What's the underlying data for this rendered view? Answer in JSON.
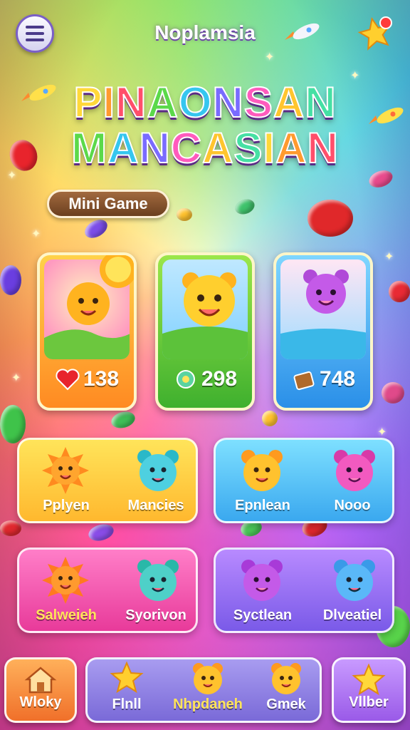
{
  "header": {
    "title": "Noplamsia",
    "menu_icon": "hamburger-menu-icon",
    "corner_icon": "star-notification-icon"
  },
  "logo": {
    "line1": [
      "P",
      "I",
      "N",
      "A",
      "O",
      "N",
      "S",
      "A",
      "N"
    ],
    "line2": [
      "M",
      "A",
      "N",
      "C",
      "A",
      "S",
      "I",
      "A",
      "N"
    ],
    "colors": [
      "#ffd83a",
      "#ff9a2e",
      "#ff4f6b",
      "#5bd94a",
      "#36c6ef",
      "#7a6bff",
      "#ff5bbd",
      "#ffc52e",
      "#46e0a4"
    ]
  },
  "mini_game_label": "Mini Game",
  "level_cards": [
    {
      "score": "138",
      "icon": "heart-icon",
      "scene": "sunny-meadow",
      "accent": "#ff9a2e"
    },
    {
      "score": "298",
      "icon": "flower-icon",
      "scene": "jungle",
      "accent": "#6ed13e"
    },
    {
      "score": "748",
      "icon": "chest-icon",
      "scene": "ocean-island",
      "accent": "#38a8f0"
    }
  ],
  "panels": [
    {
      "color": "yellow",
      "characters": [
        {
          "name": "Pplyen",
          "icon": "sun-creature-icon"
        },
        {
          "name": "Mancies",
          "icon": "blue-bear-icon"
        }
      ]
    },
    {
      "color": "blue",
      "characters": [
        {
          "name": "Epnlean",
          "icon": "yellow-bear-icon"
        },
        {
          "name": "Nooo",
          "icon": "pink-bear-icon"
        }
      ]
    },
    {
      "color": "pink",
      "characters": [
        {
          "name": "Salweieh",
          "icon": "sun-creature-icon"
        },
        {
          "name": "Syorivon",
          "icon": "teal-bear-icon"
        }
      ]
    },
    {
      "color": "purple",
      "characters": [
        {
          "name": "Syctlean",
          "icon": "purple-bear-icon"
        },
        {
          "name": "Dlveatiel",
          "icon": "blue-bear-icon"
        }
      ]
    }
  ],
  "nav": [
    {
      "label": "Wloky",
      "icon": "home-icon"
    },
    {
      "label": "Flnll",
      "icon": "star-icon"
    },
    {
      "label": "Nhpdaneh",
      "icon": "bear-face-icon"
    },
    {
      "label": "Gmek",
      "icon": "bear-face-icon"
    },
    {
      "label": "Vllber",
      "icon": "star-badge-icon"
    }
  ]
}
